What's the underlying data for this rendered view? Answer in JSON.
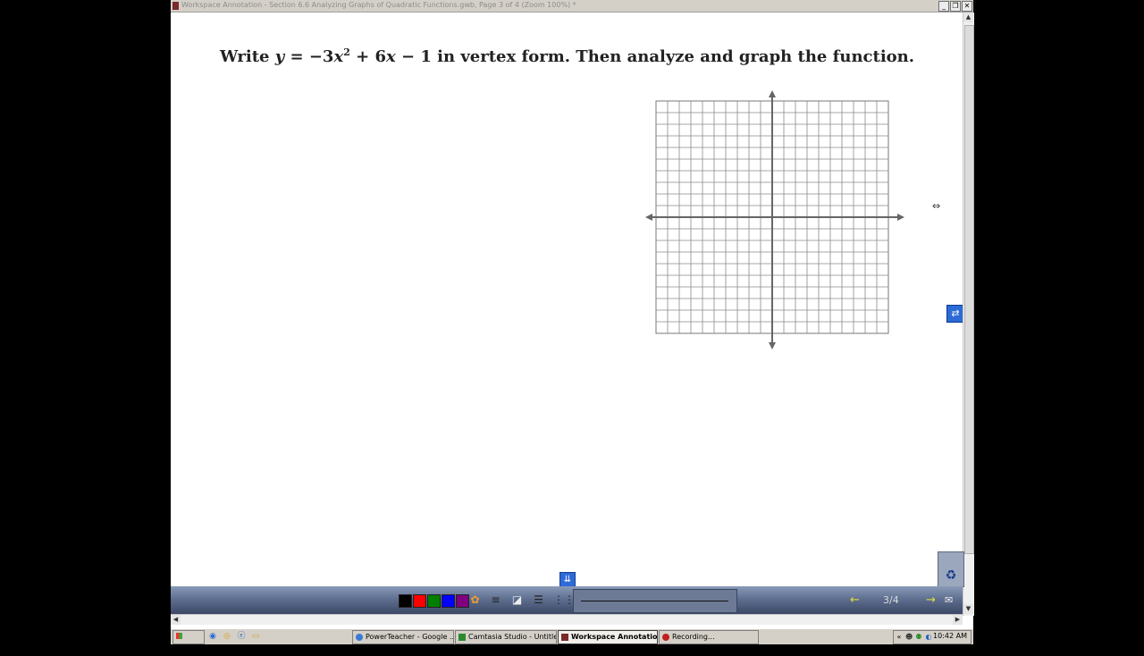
{
  "window": {
    "title": "Workspace Annotation - Section 6.6 Analyzing Graphs of Quadratic Functions.gwb, Page 3 of 4 (Zoom 100%) *",
    "controls": [
      "_",
      "❐",
      "✕"
    ]
  },
  "page": {
    "question_prefix": "Write ",
    "question_y": "y",
    "question_eq": " = −3",
    "question_x": "x",
    "question_sup": "2",
    "question_plus": " + 6",
    "question_x2": "x",
    "question_tail": " − 1 in vertex form. Then analyze and graph the function."
  },
  "graph": {
    "cells": 20
  },
  "toolbar": {
    "colors": [
      "#000000",
      "#ff0000",
      "#008000",
      "#0000ff",
      "#800080"
    ],
    "page_indicator": "3/4",
    "prev_icon": "←",
    "next_icon": "→"
  },
  "taskbar": {
    "start_label": "Start",
    "tasks": [
      {
        "label": "PowerTeacher - Google ...",
        "color": "#3a7bd5"
      },
      {
        "label": "Camtasia Studio - Untitle...",
        "color": "#2d8a2d"
      },
      {
        "label": "Workspace Annotatio...",
        "color": "#7a2a2a"
      },
      {
        "label": "Recording...",
        "color": "#c02020"
      }
    ],
    "clock": "10:42 AM"
  },
  "icons": {
    "page_collapse": "chevron-double-down-icon",
    "side_tab": "page-swap-icon",
    "recycle": "recycle-bin-icon",
    "pen_tools": [
      "palette-icon",
      "line-width-icon",
      "eraser-icon",
      "line-style-icon",
      "grid-icon"
    ]
  }
}
